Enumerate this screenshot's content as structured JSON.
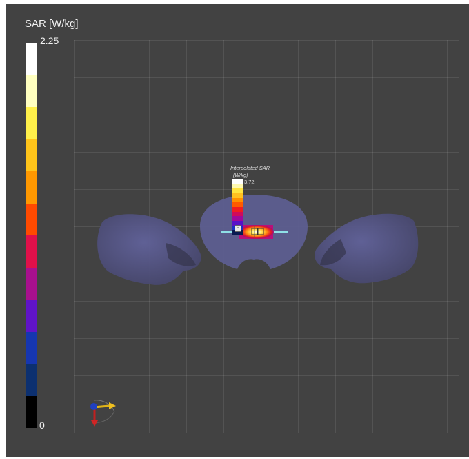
{
  "sar_legend": {
    "title": "SAR [W/kg]",
    "max_label": "2.25",
    "min_label": "0",
    "colors": [
      "#ffffff",
      "#ffffc0",
      "#fff04a",
      "#ffc41a",
      "#ff9800",
      "#ff4a00",
      "#e0104a",
      "#a8108e",
      "#6014c8",
      "#1636b0",
      "#0c3070",
      "#000000"
    ]
  },
  "interpolated": {
    "title": "Interpolated SAR",
    "unit": "[W/kg]",
    "max_label": "3.72",
    "colors": [
      "#ffffff",
      "#fff9b0",
      "#ffe440",
      "#ffc020",
      "#ff9000",
      "#ff5a00",
      "#f01c20",
      "#d00a5a",
      "#a0089a",
      "#5810c8",
      "#1c30c0",
      "#0a1a50"
    ]
  },
  "colors": {
    "background": "#424242",
    "grid_line": "rgba(255,255,255,0.09)",
    "phantom": "#58588a",
    "probe_line": "#8fe0e6"
  },
  "icons": {
    "axes": "orientation-axes-icon",
    "probe_marker": "probe-marker-icon"
  }
}
